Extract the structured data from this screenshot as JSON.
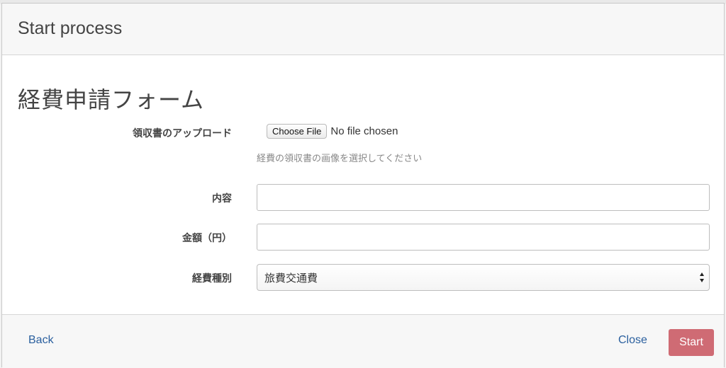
{
  "modal": {
    "title": "Start process"
  },
  "form": {
    "title": "経費申請フォーム",
    "receipt": {
      "label": "領収書のアップロード",
      "button_label": "Choose File",
      "status": "No file chosen",
      "help": "経費の領収書の画像を選択してください"
    },
    "content": {
      "label": "内容",
      "value": ""
    },
    "amount": {
      "label": "金額（円）",
      "value": ""
    },
    "category": {
      "label": "経費種別",
      "selected": "旅費交通費"
    }
  },
  "footer": {
    "back_label": "Back",
    "close_label": "Close",
    "start_label": "Start"
  },
  "colors": {
    "start_button": "#cf6b74",
    "link": "#2a5f9e"
  }
}
